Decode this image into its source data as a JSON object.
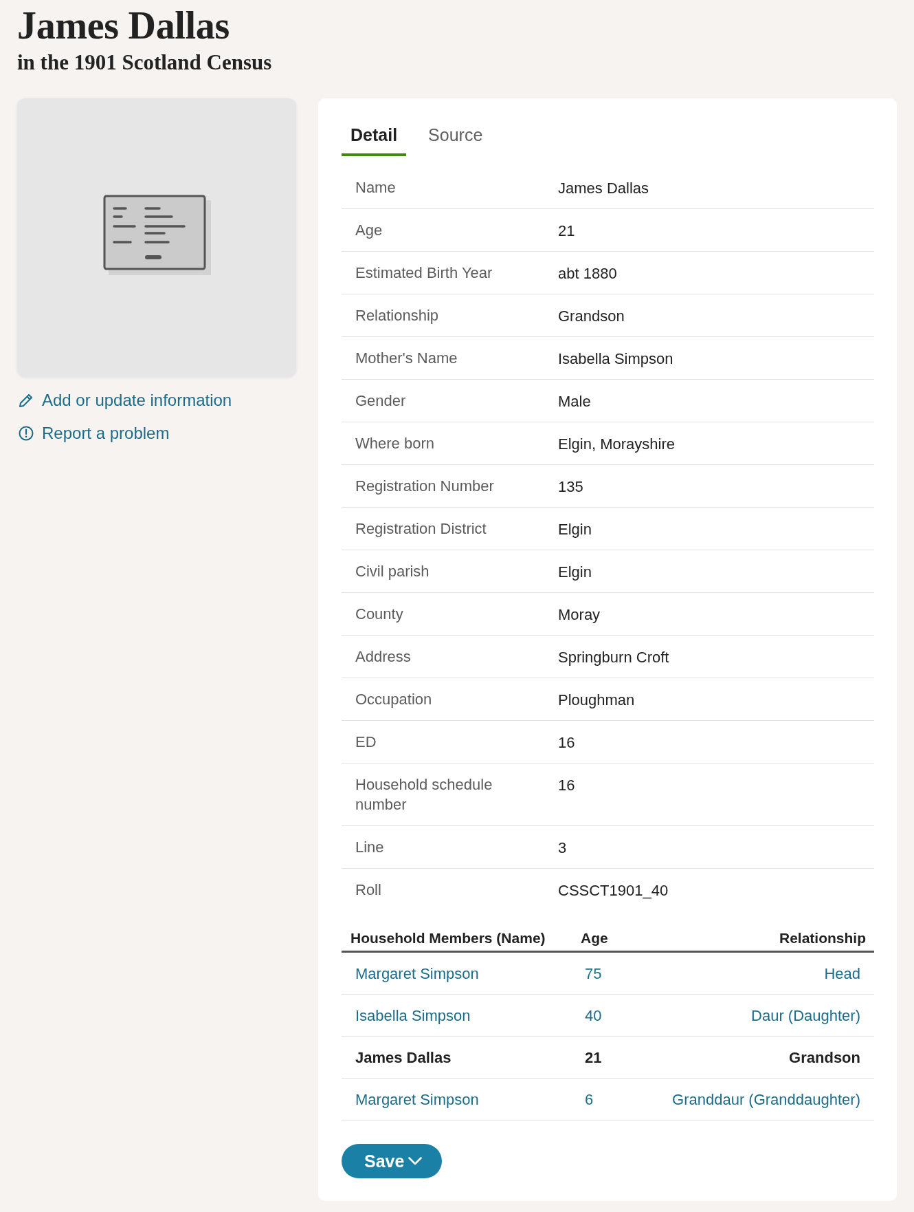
{
  "header": {
    "title": "James Dallas",
    "subtitle": "in the 1901 Scotland Census"
  },
  "sidebar": {
    "links": [
      {
        "kind": "edit",
        "label": "Add or update information"
      },
      {
        "kind": "report",
        "label": "Report a problem"
      }
    ]
  },
  "tabs": [
    {
      "label": "Detail",
      "selected": true
    },
    {
      "label": "Source",
      "selected": false
    }
  ],
  "details": [
    {
      "label": "Name",
      "value": "James Dallas"
    },
    {
      "label": "Age",
      "value": "21"
    },
    {
      "label": "Estimated Birth Year",
      "value": "abt 1880"
    },
    {
      "label": "Relationship",
      "value": "Grandson"
    },
    {
      "label": "Mother's Name",
      "value": "Isabella Simpson"
    },
    {
      "label": "Gender",
      "value": "Male"
    },
    {
      "label": "Where born",
      "value": "Elgin, Morayshire"
    },
    {
      "label": "Registration Number",
      "value": "135"
    },
    {
      "label": "Registration District",
      "value": "Elgin"
    },
    {
      "label": "Civil parish",
      "value": "Elgin"
    },
    {
      "label": "County",
      "value": "Moray"
    },
    {
      "label": "Address",
      "value": "Springburn Croft"
    },
    {
      "label": "Occupation",
      "value": "Ploughman"
    },
    {
      "label": "ED",
      "value": "16"
    },
    {
      "label": "Household schedule number",
      "value": "16"
    },
    {
      "label": "Line",
      "value": "3"
    },
    {
      "label": "Roll",
      "value": "CSSCT1901_40"
    }
  ],
  "household": {
    "columns": [
      "Household Members (Name)",
      "Age",
      "Relationship"
    ],
    "rows": [
      {
        "name": "Margaret Simpson",
        "age": "75",
        "relationship": "Head",
        "current": false
      },
      {
        "name": "Isabella Simpson",
        "age": "40",
        "relationship": "Daur (Daughter)",
        "current": false
      },
      {
        "name": "James Dallas",
        "age": "21",
        "relationship": "Grandson",
        "current": true
      },
      {
        "name": "Margaret Simpson",
        "age": "6",
        "relationship": "Granddaur (Granddaughter)",
        "current": false
      }
    ]
  },
  "save_button": {
    "label": "Save"
  }
}
